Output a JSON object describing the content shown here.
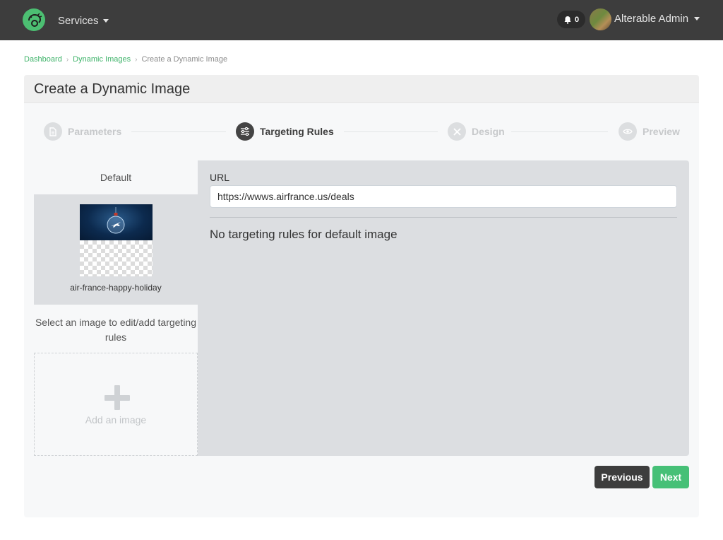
{
  "navbar": {
    "services_label": "Services",
    "notification_count": "0",
    "user_name": "Alterable Admin"
  },
  "breadcrumb": {
    "items": [
      "Dashboard",
      "Dynamic Images"
    ],
    "current": "Create a Dynamic Image"
  },
  "page": {
    "title": "Create a Dynamic Image"
  },
  "stepper": {
    "steps": [
      {
        "label": "Parameters",
        "state": "inactive",
        "icon": "document-icon"
      },
      {
        "label": "Targeting Rules",
        "state": "active",
        "icon": "sliders-icon"
      },
      {
        "label": "Design",
        "state": "inactive",
        "icon": "design-tools-icon"
      },
      {
        "label": "Preview",
        "state": "inactive",
        "icon": "eye-icon"
      }
    ]
  },
  "images": {
    "default_label": "Default",
    "items": [
      {
        "name": "air-france-happy-holiday"
      }
    ],
    "select_hint": "Select an image to edit/add targeting rules",
    "add_label": "Add an image"
  },
  "rules": {
    "url_label": "URL",
    "url_value": "https://wwws.airfrance.us/deals",
    "empty_message": "No targeting rules for default image"
  },
  "actions": {
    "previous_label": "Previous",
    "next_label": "Next"
  },
  "colors": {
    "accent": "#46c077",
    "navbar": "#3d3d3d",
    "link": "#3fb36a"
  }
}
